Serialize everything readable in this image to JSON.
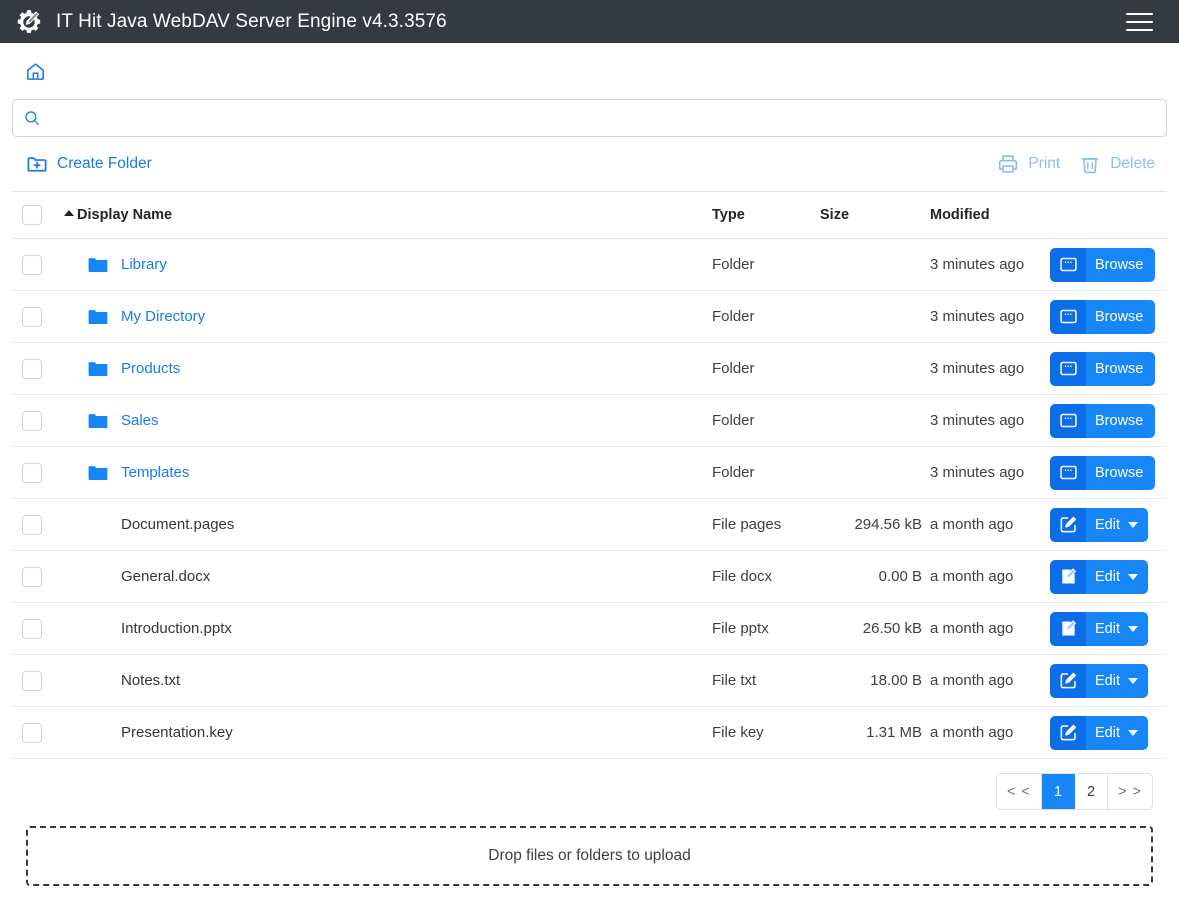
{
  "navbar": {
    "logo_icon": "gear-pencil-icon",
    "title": "IT Hit Java WebDAV Server Engine v4.3.3576",
    "menu_icon": "hamburger-menu-icon"
  },
  "breadcrumb": {
    "home_icon": "home-icon"
  },
  "search": {
    "icon": "search-icon",
    "value": "",
    "placeholder": ""
  },
  "toolbar": {
    "create_folder_label": "Create Folder",
    "create_folder_icon": "folder-plus-icon",
    "print_label": "Print",
    "print_icon": "printer-icon",
    "delete_label": "Delete",
    "delete_icon": "trash-icon"
  },
  "table": {
    "sort_column": "Display Name",
    "sort_direction": "asc",
    "headers": {
      "name": "Display Name",
      "type": "Type",
      "size": "Size",
      "modified": "Modified"
    },
    "rows": [
      {
        "name": "Library",
        "is_folder": true,
        "icon": "folder-icon",
        "type": "Folder",
        "size": "",
        "modified": "3 minutes ago",
        "action_label": "Browse",
        "action_icon": "browser-window-icon",
        "has_dropdown": false
      },
      {
        "name": "My Directory",
        "is_folder": true,
        "icon": "folder-icon",
        "type": "Folder",
        "size": "",
        "modified": "3 minutes ago",
        "action_label": "Browse",
        "action_icon": "browser-window-icon",
        "has_dropdown": false
      },
      {
        "name": "Products",
        "is_folder": true,
        "icon": "folder-icon",
        "type": "Folder",
        "size": "",
        "modified": "3 minutes ago",
        "action_label": "Browse",
        "action_icon": "browser-window-icon",
        "has_dropdown": false
      },
      {
        "name": "Sales",
        "is_folder": true,
        "icon": "folder-icon",
        "type": "Folder",
        "size": "",
        "modified": "3 minutes ago",
        "action_label": "Browse",
        "action_icon": "browser-window-icon",
        "has_dropdown": false
      },
      {
        "name": "Templates",
        "is_folder": true,
        "icon": "folder-icon",
        "type": "Folder",
        "size": "",
        "modified": "3 minutes ago",
        "action_label": "Browse",
        "action_icon": "browser-window-icon",
        "has_dropdown": false
      },
      {
        "name": "Document.pages",
        "is_folder": false,
        "icon": "",
        "type": "File pages",
        "size": "294.56 kB",
        "modified": "a month ago",
        "action_label": "Edit",
        "action_icon": "pencil-square-icon",
        "has_dropdown": true
      },
      {
        "name": "General.docx",
        "is_folder": false,
        "icon": "",
        "type": "File docx",
        "size": "0.00 B",
        "modified": "a month ago",
        "action_label": "Edit",
        "action_icon": "office-doc-icon",
        "has_dropdown": true
      },
      {
        "name": "Introduction.pptx",
        "is_folder": false,
        "icon": "",
        "type": "File pptx",
        "size": "26.50 kB",
        "modified": "a month ago",
        "action_label": "Edit",
        "action_icon": "office-doc-icon",
        "has_dropdown": true
      },
      {
        "name": "Notes.txt",
        "is_folder": false,
        "icon": "",
        "type": "File txt",
        "size": "18.00 B",
        "modified": "a month ago",
        "action_label": "Edit",
        "action_icon": "pencil-square-icon",
        "has_dropdown": true
      },
      {
        "name": "Presentation.key",
        "is_folder": false,
        "icon": "",
        "type": "File key",
        "size": "1.31 MB",
        "modified": "a month ago",
        "action_label": "Edit",
        "action_icon": "pencil-square-icon",
        "has_dropdown": true
      }
    ]
  },
  "pagination": {
    "first_label": "< <",
    "last_label": "> >",
    "pages": [
      "1",
      "2"
    ],
    "current_page": "1"
  },
  "dropzone": {
    "label": "Drop files or folders to upload"
  },
  "colors": {
    "navbar_bg": "#343a40",
    "accent": "#1787f7",
    "accent_dark": "#0b6ee8",
    "link": "#1a7bf0",
    "disabled": "#8dbdf5"
  }
}
